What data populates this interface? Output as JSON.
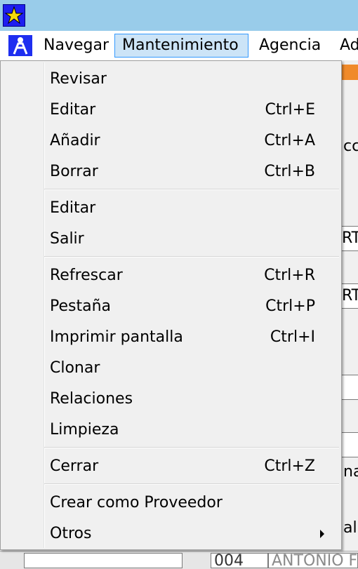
{
  "menubar": {
    "items": [
      {
        "label": "Navegar"
      },
      {
        "label": "Mantenimiento"
      },
      {
        "label": "Agencia"
      },
      {
        "label": "Ad"
      }
    ]
  },
  "menu": {
    "items": [
      {
        "label": "Revisar",
        "shortcut": ""
      },
      {
        "label": "Editar",
        "shortcut": "Ctrl+E"
      },
      {
        "label": "Añadir",
        "shortcut": "Ctrl+A"
      },
      {
        "label": "Borrar",
        "shortcut": "Ctrl+B"
      },
      {
        "label": "Editar",
        "shortcut": ""
      },
      {
        "label": "Salir",
        "shortcut": ""
      },
      {
        "label": "Refrescar",
        "shortcut": "Ctrl+R"
      },
      {
        "label": "Pestaña",
        "shortcut": "Ctrl+P"
      },
      {
        "label": "Imprimir pantalla",
        "shortcut": "Ctrl+I"
      },
      {
        "label": "Clonar",
        "shortcut": ""
      },
      {
        "label": "Relaciones",
        "shortcut": ""
      },
      {
        "label": "Limpieza",
        "shortcut": ""
      },
      {
        "label": "Cerrar",
        "shortcut": "Ctrl+Z"
      },
      {
        "label": "Crear como Proveedor",
        "shortcut": ""
      },
      {
        "label": "Otros",
        "shortcut": "",
        "submenu": true
      }
    ]
  },
  "background": {
    "fragments": [
      "cci",
      "RT-",
      "RT-",
      "na",
      "al"
    ],
    "bottom_code": "004",
    "bottom_name": "ANTONIO F"
  },
  "colors": {
    "titlebar": "#99ccea",
    "menu_active_bg": "#cce4f7",
    "menu_active_border": "#3399ff",
    "tab_accent": "#f08a2a"
  },
  "icons": {
    "title": "app-star-icon",
    "menubar": "app-figure-icon",
    "submenu": "submenu-arrow-icon"
  }
}
